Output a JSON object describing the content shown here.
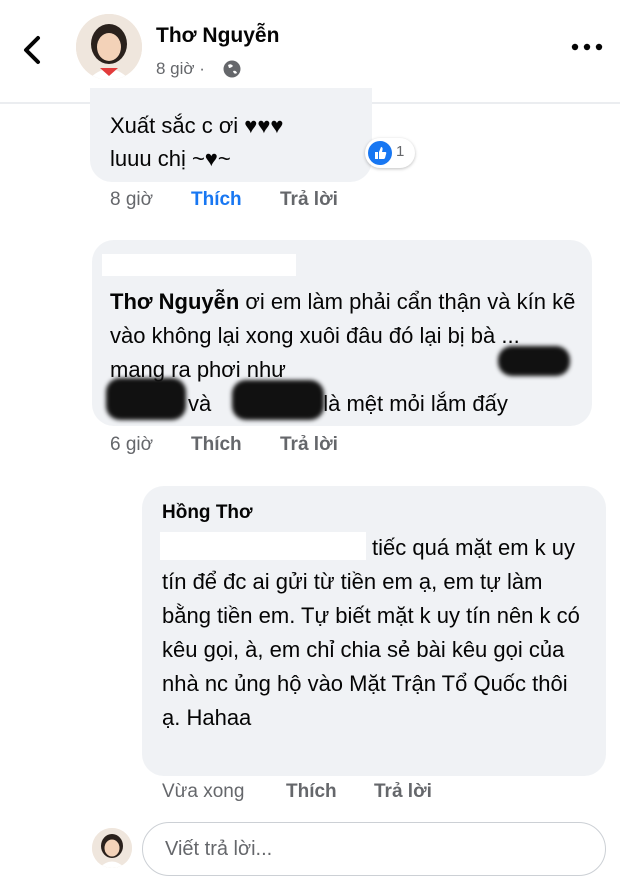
{
  "header": {
    "name": "Thơ Nguyễn",
    "time": "8 giờ ·"
  },
  "comment1": {
    "text": "Xuất sắc c ơi ♥♥♥\nluuu chị ~♥~",
    "like_count": "1",
    "time": "8 giờ",
    "like_label": "Thích",
    "reply_label": "Trả lời"
  },
  "comment2": {
    "mention": "Thơ Nguyễn",
    "text_after_mention": " ơi em làm phải cẩn thận và kín kẽ vào không lại xong xuôi đâu đó lại bị bà ... mang ra phơi như",
    "text_line4_mid": "và",
    "text_line4_end": "là mệt mỏi lắm đấy",
    "time": "6 giờ",
    "like_label": "Thích",
    "reply_label": "Trả lời"
  },
  "comment3": {
    "name": "Hồng Thơ",
    "text": "tiếc quá mặt em k uy tín để đc ai gửi từ tiền em ạ, em tự làm bằng tiền em. Tự biết mặt k uy tín nên k có kêu gọi, à, em chỉ chia sẻ bài kêu gọi của nhà nc ủng hộ vào Mặt Trận Tổ Quốc thôi ạ. Hahaa",
    "time": "Vừa xong",
    "like_label": "Thích",
    "reply_label": "Trả lời"
  },
  "reply_input": {
    "placeholder": "Viết trả lời..."
  },
  "colors": {
    "accent": "#1877f2",
    "bubble": "#f0f2f5",
    "muted": "#65676b"
  }
}
